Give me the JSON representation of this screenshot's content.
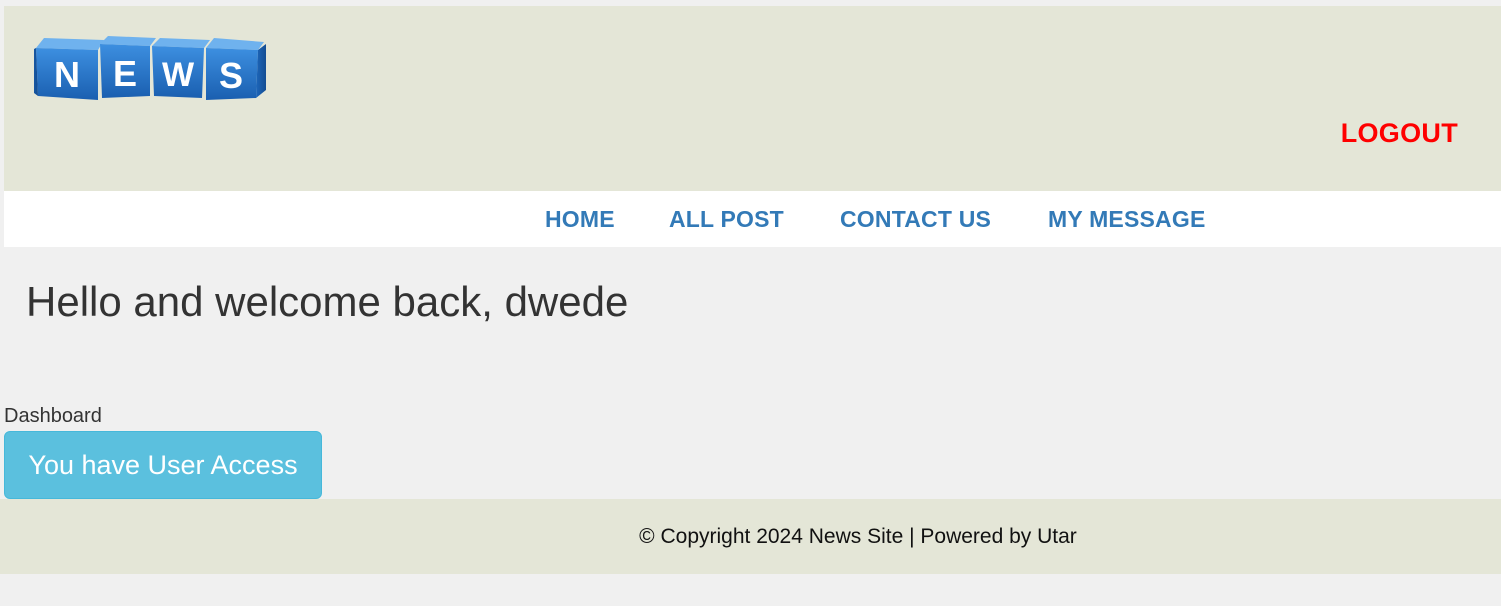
{
  "header": {
    "logo": {
      "letters": [
        "N",
        "E",
        "W",
        "S"
      ],
      "cube_color": "#1f6fc9",
      "letter_color": "#ffffff"
    },
    "logout_label": "LOGOUT",
    "logout_color": "#ff0000",
    "background": "#e4e6d7"
  },
  "nav": {
    "items": [
      {
        "label": "HOME"
      },
      {
        "label": "ALL POST"
      },
      {
        "label": "CONTACT US"
      },
      {
        "label": "MY MESSAGE"
      }
    ],
    "link_color": "#337ab7"
  },
  "main": {
    "welcome": "Hello and welcome back, dwede",
    "dashboard_label": "Dashboard",
    "access_button_label": "You have User Access",
    "access_button_color": "#5bc0de"
  },
  "footer": {
    "text": "© Copyright 2024 News Site | Powered by Utar"
  }
}
